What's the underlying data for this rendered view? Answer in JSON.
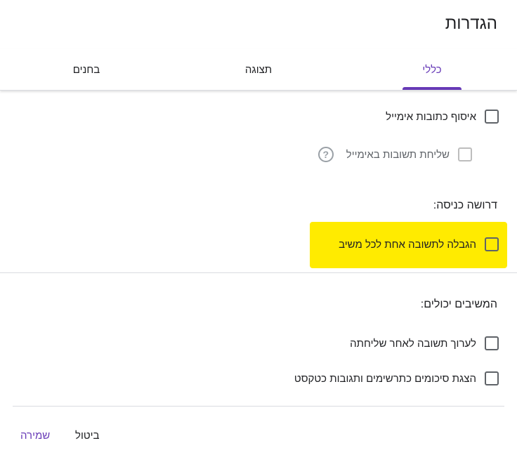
{
  "dialog": {
    "title": "הגדרות"
  },
  "tabs": [
    {
      "label": "כללי",
      "active": true
    },
    {
      "label": "תצוגה",
      "active": false
    },
    {
      "label": "בחנים",
      "active": false
    }
  ],
  "general": {
    "collect_email": {
      "label": "איסוף כתובות אימייל",
      "checked": false
    },
    "send_responses": {
      "label": "שליחת תשובות באימייל",
      "checked": false,
      "disabled": true
    },
    "requires_login": {
      "heading": "דרושה כניסה:",
      "limit_one_response": {
        "label": "הגבלה לתשובה אחת לכל משיב",
        "checked": false
      }
    },
    "respondents_can": {
      "heading": "המשיבים יכולים:",
      "edit_after_submit": {
        "label": "לערוך תשובה לאחר שליחתה",
        "checked": false
      },
      "see_summary": {
        "label": "הצגת סיכומים כתרשימים ותגובות כטקסט",
        "checked": false
      }
    }
  },
  "footer": {
    "cancel_label": "ביטול",
    "save_label": "שמירה"
  },
  "colors": {
    "accent": "#673ab7",
    "highlight": "#ffeb00"
  },
  "icons": {
    "help": "help-circle-icon"
  }
}
